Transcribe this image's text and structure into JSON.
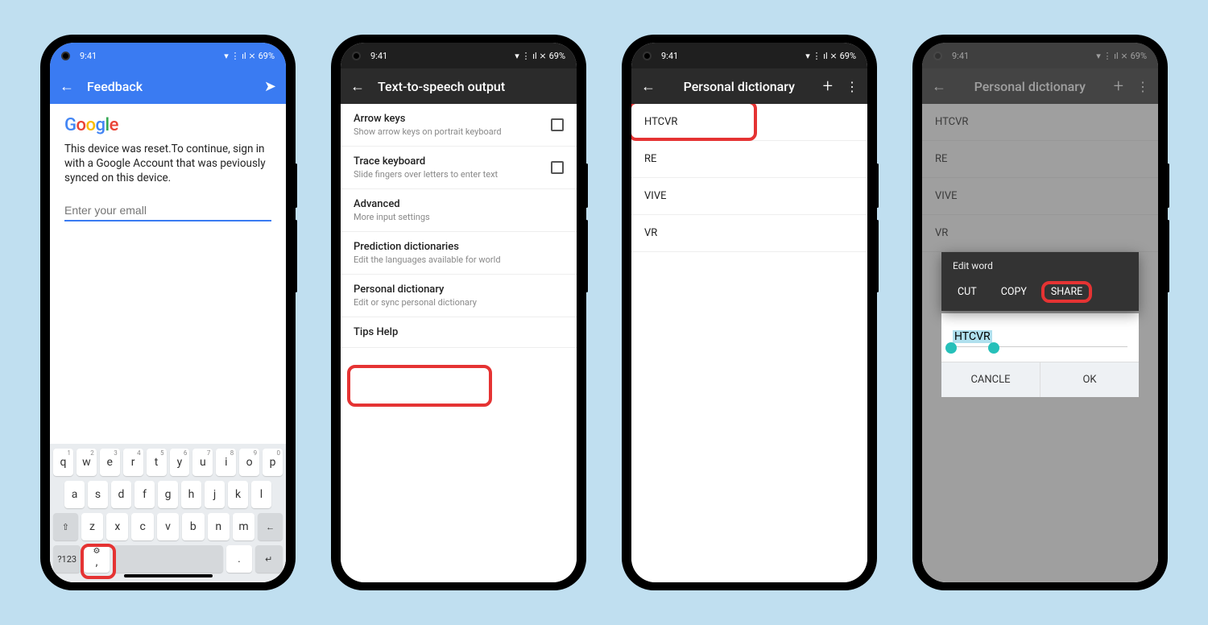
{
  "status": {
    "time": "9:41",
    "battery": "69%",
    "signal": "▾ ⋮ ıl ⨯"
  },
  "s1": {
    "title": "Feedback",
    "logo": {
      "g": "G",
      "o1": "o",
      "o2": "o",
      "g2": "g",
      "l": "l",
      "e": "e"
    },
    "reset_text": "This device was reset.To continue, sign in with a Google Account that was peviously synced on this device.",
    "email_placeholder": "Enter your emall",
    "keys_r1": [
      "q",
      "w",
      "e",
      "r",
      "t",
      "y",
      "u",
      "i",
      "o",
      "p"
    ],
    "keys_r1_sup": [
      "1",
      "2",
      "3",
      "4",
      "5",
      "6",
      "7",
      "8",
      "9",
      "0"
    ],
    "keys_r2": [
      "a",
      "s",
      "d",
      "f",
      "g",
      "h",
      "j",
      "k",
      "l"
    ],
    "keys_r3": [
      "z",
      "x",
      "c",
      "v",
      "b",
      "n",
      "m"
    ],
    "fn123": "?123",
    "comma_gear": "⚙",
    "period": ".",
    "shift": "⇧",
    "bksp": "←",
    "enter": "↵"
  },
  "s2": {
    "title": "Text-to-speech output",
    "rows": [
      {
        "title": "Arrow keys",
        "sub": "Show arrow keys on portrait keyboard",
        "checkbox": true
      },
      {
        "title": "Trace keyboard",
        "sub": "Slide fingers over letters to enter text",
        "checkbox": true
      },
      {
        "title": "Advanced",
        "sub": "More input settings",
        "checkbox": false
      },
      {
        "title": "Prediction dictionaries",
        "sub": "Edit the languages available for world",
        "checkbox": false
      },
      {
        "title": "Personal dictionary",
        "sub": "Edit or sync personal dictionary",
        "checkbox": false
      },
      {
        "title": "Tips Help",
        "sub": "",
        "checkbox": false
      }
    ]
  },
  "s3": {
    "title": "Personal dictionary",
    "words": [
      "HTCVR",
      "RE",
      "VIVE",
      "VR"
    ]
  },
  "s4": {
    "title": "Personal dictionary",
    "words": [
      "HTCVR",
      "RE",
      "VIVE",
      "VR"
    ],
    "ctx_title": "Edit word",
    "ctx": [
      "CUT",
      "COPY",
      "SHARE"
    ],
    "selected": "HTCVR",
    "cancel": "CANCLE",
    "ok": "OK"
  }
}
